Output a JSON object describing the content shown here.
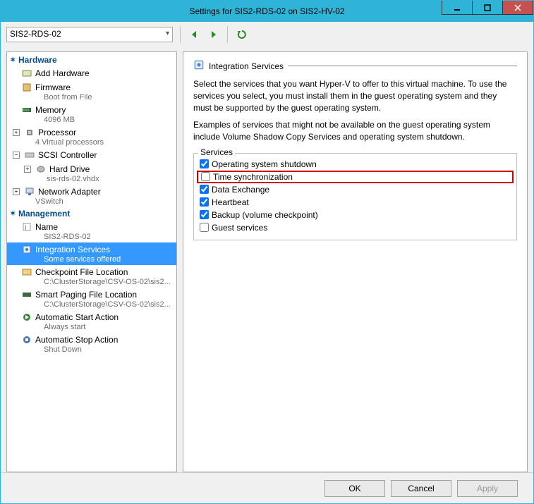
{
  "window": {
    "title": "Settings for SIS2-RDS-02 on SIS2-HV-02"
  },
  "toolbar": {
    "vm_selected": "SIS2-RDS-02"
  },
  "sections": {
    "hardware_label": "Hardware",
    "management_label": "Management"
  },
  "tree": {
    "add_hardware": "Add Hardware",
    "firmware": {
      "label": "Firmware",
      "sub": "Boot from File"
    },
    "memory": {
      "label": "Memory",
      "sub": "4096 MB"
    },
    "processor": {
      "label": "Processor",
      "sub": "4 Virtual processors"
    },
    "scsi": {
      "label": "SCSI Controller"
    },
    "hard_drive": {
      "label": "Hard Drive",
      "sub": "sis-rds-02.vhdx"
    },
    "network": {
      "label": "Network Adapter",
      "sub": "VSwitch"
    },
    "name": {
      "label": "Name",
      "sub": "SIS2-RDS-02"
    },
    "integration": {
      "label": "Integration Services",
      "sub": "Some services offered"
    },
    "checkpoint": {
      "label": "Checkpoint File Location",
      "sub": "C:\\ClusterStorage\\CSV-OS-02\\sis2..."
    },
    "paging": {
      "label": "Smart Paging File Location",
      "sub": "C:\\ClusterStorage\\CSV-OS-02\\sis2..."
    },
    "autostart": {
      "label": "Automatic Start Action",
      "sub": "Always start"
    },
    "autostop": {
      "label": "Automatic Stop Action",
      "sub": "Shut Down"
    }
  },
  "content": {
    "header": "Integration Services",
    "desc1": "Select the services that you want Hyper-V to offer to this virtual machine. To use the services you select, you must install them in the guest operating system and they must be supported by the guest operating system.",
    "desc2": "Examples of services that might not be available on the guest operating system include Volume Shadow Copy Services and operating system shutdown.",
    "group_label": "Services",
    "services": [
      {
        "label": "Operating system shutdown",
        "checked": true,
        "highlight": false
      },
      {
        "label": "Time synchronization",
        "checked": false,
        "highlight": true
      },
      {
        "label": "Data Exchange",
        "checked": true,
        "highlight": false
      },
      {
        "label": "Heartbeat",
        "checked": true,
        "highlight": false
      },
      {
        "label": "Backup (volume checkpoint)",
        "checked": true,
        "highlight": false
      },
      {
        "label": "Guest services",
        "checked": false,
        "highlight": false
      }
    ]
  },
  "buttons": {
    "ok": "OK",
    "cancel": "Cancel",
    "apply": "Apply"
  }
}
